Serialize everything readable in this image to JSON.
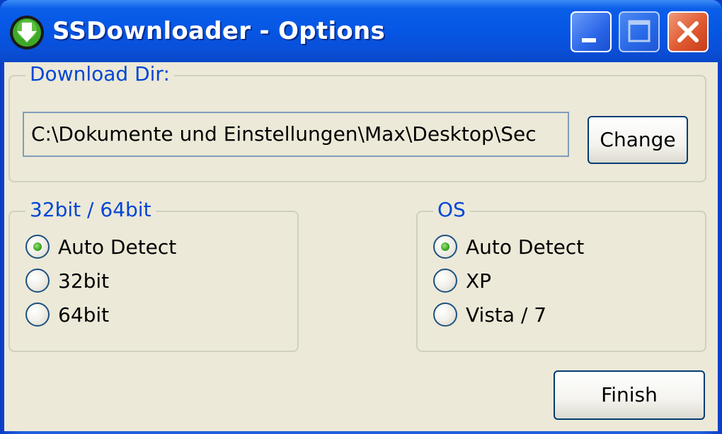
{
  "window": {
    "title": "SSDownloader - Options"
  },
  "download_dir": {
    "label": "Download Dir:",
    "path_value": "C:\\Dokumente und Einstellungen\\Max\\Desktop\\Sec",
    "change_label": "Change"
  },
  "bits": {
    "label": "32bit / 64bit",
    "options": [
      {
        "label": "Auto Detect",
        "checked": true
      },
      {
        "label": "32bit",
        "checked": false
      },
      {
        "label": "64bit",
        "checked": false
      }
    ]
  },
  "os": {
    "label": "OS",
    "options": [
      {
        "label": "Auto Detect",
        "checked": true
      },
      {
        "label": "XP",
        "checked": false
      },
      {
        "label": "Vista / 7",
        "checked": false
      }
    ]
  },
  "footer": {
    "finish_label": "Finish"
  },
  "icons": {
    "app": "download-arrow-icon",
    "minimize": "minimize-icon",
    "maximize": "maximize-icon",
    "close": "close-icon"
  },
  "colors": {
    "titlebar": "#0556e4",
    "group_label": "#0046d5",
    "dialog_bg": "#ece9d8",
    "close_button": "#e05a30",
    "radio_dot": "#3aa71f"
  }
}
